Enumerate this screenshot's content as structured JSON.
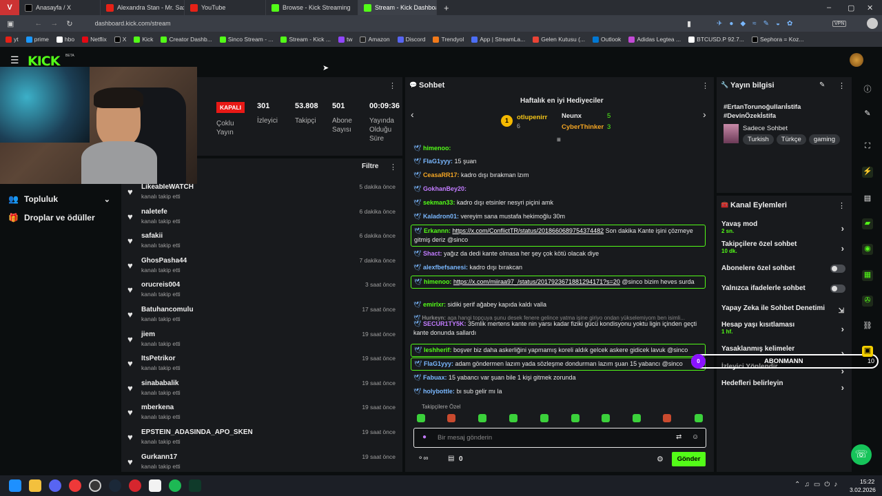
{
  "browser": {
    "tabs": [
      "Anasayfa / X",
      "Alexandra Stan - Mr. Saxob...",
      "YouTube",
      "Browse - Kick Streaming",
      "Stream - Kick Dashboard"
    ],
    "url": "dashboard.kick.com/stream",
    "bookmarks": [
      "yt",
      "prime",
      "hbo",
      "Netflix",
      "X",
      "Kick",
      "Creator Dashb...",
      "Sinco Stream - ...",
      "Stream - Kick ...",
      "tw",
      "Amazon",
      "Discord",
      "Trendyol",
      "App | StreamLa...",
      "Gelen Kutusu (...",
      "Outlook",
      "Adidas Legtea ...",
      "BTCUSD.P 92.7...",
      "Sephora = Koz..."
    ]
  },
  "header": {
    "logo": "KICK",
    "beta": "BETA"
  },
  "sidebar": {
    "community": "Topluluk",
    "drops": "Droplar ve ödüller"
  },
  "stream": {
    "status": "KAPALI",
    "multi": "Çoklu Yayın",
    "viewers": "301",
    "viewers_label": "İzleyici",
    "followers": "53.808",
    "followers_label": "Takipçi",
    "subs": "501",
    "subs_label": "Abone Sayısı",
    "uptime": "00:09:36",
    "uptime_label": "Yayında Olduğu Süre"
  },
  "activity": {
    "filter": "Filtre",
    "items": [
      {
        "name": "LikeableWATCH",
        "sub": "kanalı takip etti",
        "time": "5 dakika önce"
      },
      {
        "name": "naletefe",
        "sub": "kanalı takip etti",
        "time": "6 dakika önce"
      },
      {
        "name": "safakii",
        "sub": "kanalı takip etti",
        "time": "6 dakika önce"
      },
      {
        "name": "GhosPasha44",
        "sub": "kanalı takip etti",
        "time": "7 dakika önce"
      },
      {
        "name": "orucreis004",
        "sub": "kanalı takip etti",
        "time": "3 saat önce"
      },
      {
        "name": "Batuhancomulu",
        "sub": "kanalı takip etti",
        "time": "17 saat önce"
      },
      {
        "name": "jiem",
        "sub": "kanalı takip etti",
        "time": "19 saat önce"
      },
      {
        "name": "ItsPetrikor",
        "sub": "kanalı takip etti",
        "time": "19 saat önce"
      },
      {
        "name": "sinababalik",
        "sub": "kanalı takip etti",
        "time": "19 saat önce"
      },
      {
        "name": "mberkena",
        "sub": "kanalı takip etti",
        "time": "19 saat önce"
      },
      {
        "name": "EPSTEIN_ADASINDA_APO_SKEN",
        "sub": "kanalı takip etti",
        "time": "19 saat önce"
      },
      {
        "name": "Gurkann17",
        "sub": "kanalı takip etti",
        "time": "19 saat önce"
      }
    ]
  },
  "chat": {
    "title": "Sohbet",
    "gifters_title": "Haftalık en iyi Hediyeciler",
    "gifters": [
      {
        "rank": "1",
        "name": "otlupenirr",
        "count": "6"
      },
      {
        "name": "Neunx",
        "count": "5"
      },
      {
        "name": "CyberThinker",
        "count": "3"
      }
    ],
    "messages": [
      {
        "user": "himenoo:",
        "text": "",
        "color": "#53fc18"
      },
      {
        "user": "FlaG1yyy:",
        "text": "15 şuan",
        "color": "#7ab8ff"
      },
      {
        "user": "CeasaRR17:",
        "text": "kadro dışı bırakman lzım",
        "color": "#f5a623"
      },
      {
        "user": "GokhanBey20:",
        "text": "",
        "color": "#c27cff"
      },
      {
        "user": "sekman33:",
        "text": "kadro dışı etsinler nesyri piçini amk",
        "color": "#53fc18"
      },
      {
        "user": "Kaladron01:",
        "text": "vereyim sana mustafa hekimoğlu 30m",
        "color": "#7ab8ff"
      },
      {
        "user": "Erkannn:",
        "link": "https://x.com/ConflictTR/status/2018660689754374482",
        "text": "Son dakika Kante işini çözmeye gitmiş deriz @sinco",
        "color": "#53fc18"
      },
      {
        "user": "Shact:",
        "text": "yağız da dedi kante olmasa her şey çok kötü olacak diye",
        "color": "#c27cff"
      },
      {
        "user": "alexfbefsanesi:",
        "text": "kadro dışı bırakcan",
        "color": "#7ab8ff"
      },
      {
        "user": "himenoo:",
        "link": "https://x.com/miiraa97_/status/2017923671881294171?s=20",
        "text": "@sinco bizim heves surda",
        "color": "#53fc18"
      },
      {
        "user": "emirlxr:",
        "text": "sidiki şerif ağabey kapıda kaldı valla",
        "color": "#53fc18"
      },
      {
        "user": "Hurkeyn:",
        "text": "aga hangi topçuya şunu desek fenere gelince yatma işine giriyo ondan yükselemiyom ben isimli...",
        "color": "#888888"
      },
      {
        "user": "SECUR1TY5K:",
        "text": "35mlik mertens kante nin yarsı kadar fiziki gücü kondisyonu yoktu ligin içinden geçti kante donunda sallardı",
        "color": "#c27cff"
      },
      {
        "user": "leshherif:",
        "text": "boşver biz daha askerliğini yapmamış koreli aldık gelcek askere gidicek lavuk @sinco",
        "color": "#53fc18"
      },
      {
        "user": "FlaG1yyy:",
        "text": "adam göndermen lazım yada sözleşme dondurman lazım şuan 15 yabancı @sinco",
        "color": "#7ab8ff"
      },
      {
        "user": "Fabuax:",
        "text": "15 yabancı var şuan bile 1 kişi gitmek zorunda",
        "color": "#7ab8ff"
      },
      {
        "user": "holybottle:",
        "text": "bı sub gelir mı la",
        "color": "#7ab8ff"
      }
    ],
    "followers_only": "Takipçilere Özel",
    "input_placeholder": "Bir mesaj gönderin",
    "send": "Gönder",
    "points": "0"
  },
  "streaminfo": {
    "title": "Yayın bilgisi",
    "hashtags": "#ErtanTorunoğullarıİstifa #DevinÖzekİstifa",
    "category": "Sadece Sohbet",
    "tags": [
      "Turkish",
      "Türkçe",
      "gaming"
    ]
  },
  "channelactions": {
    "title": "Kanal Eylemleri",
    "items": [
      {
        "label": "Yavaş mod",
        "sub": "2 sn.",
        "kind": "chevron"
      },
      {
        "label": "Takipçilere özel sohbet",
        "sub": "10 dk.",
        "kind": "chevron"
      },
      {
        "label": "Abonelere özel sohbet",
        "sub": "",
        "kind": "toggle"
      },
      {
        "label": "Yalnızca ifadelerle sohbet",
        "sub": "",
        "kind": "toggle"
      },
      {
        "label": "Yapay Zeka ile Sohbet Denetimi",
        "sub": "",
        "kind": "external"
      },
      {
        "label": "Hesap yaşı kısıtlaması",
        "sub": "1 hf.",
        "kind": "chevron"
      },
      {
        "label": "Yasaklanmış kelimeler",
        "sub": "",
        "kind": "chevron"
      },
      {
        "label": "İzleyici Yönlendir",
        "sub": "",
        "kind": "chevron"
      },
      {
        "label": "Hedefleri belirleyin",
        "sub": "",
        "kind": "chevron"
      }
    ],
    "overlay_label": "ABONMANN",
    "overlay_count": "10",
    "overlay_badge": "0"
  },
  "taskbar": {
    "time": "15:22",
    "date": "3.02.2026"
  }
}
